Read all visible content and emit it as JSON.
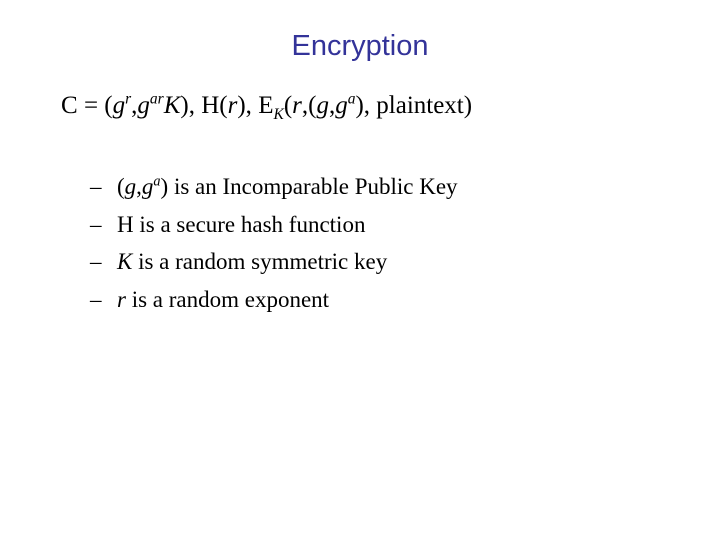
{
  "slide": {
    "title": "Encryption",
    "title_color": "#333399",
    "body_color": "#000000",
    "background_color": "#ffffff",
    "formula": {
      "full_text": "C = (gᵣ,gᵃʳK), H(r), Eₖ(r,(g,gᵃ), plaintext)",
      "parts": {
        "lhs": "C",
        "equals": " = ",
        "open_paren": "(",
        "g1_base": "g",
        "g1_exp": "r",
        "comma1": ",",
        "g2_base": "g",
        "g2_exp": "ar",
        "k_sym": "K",
        "close_paren1": "), ",
        "h_sym": "H",
        "h_open": "(",
        "h_arg": "r",
        "h_close": "), ",
        "e_sym": "E",
        "e_sub": "K",
        "e_open": "(",
        "e_arg1": "r",
        "e_comma": ",",
        "e_open2": "(",
        "e_g": "g",
        "e_comma2": ",",
        "e_g2_base": "g",
        "e_g2_exp": "a",
        "e_close2": "), ",
        "plaintext": "plaintext",
        "e_close": ")"
      }
    },
    "bullets": [
      {
        "marker": "–",
        "segments": [
          {
            "text": "(",
            "style": "normal"
          },
          {
            "text": "g",
            "style": "italic"
          },
          {
            "text": ",",
            "style": "normal"
          },
          {
            "text": "g",
            "style": "italic"
          },
          {
            "text": "a",
            "style": "superscript"
          },
          {
            "text": ") is an Incomparable Public Key",
            "style": "normal"
          }
        ],
        "plain_text": "(g,gᵃ) is an Incomparable Public Key"
      },
      {
        "marker": "–",
        "segments": [
          {
            "text": "H is a secure hash function",
            "style": "normal"
          }
        ],
        "plain_text": "H is a secure hash function"
      },
      {
        "marker": "–",
        "segments": [
          {
            "text": "K",
            "style": "italic"
          },
          {
            "text": " is a random symmetric key",
            "style": "normal"
          }
        ],
        "plain_text": "K is a random symmetric key"
      },
      {
        "marker": "–",
        "segments": [
          {
            "text": "r",
            "style": "italic"
          },
          {
            "text": " is a random exponent",
            "style": "normal"
          }
        ],
        "plain_text": "r is a random exponent"
      }
    ]
  }
}
